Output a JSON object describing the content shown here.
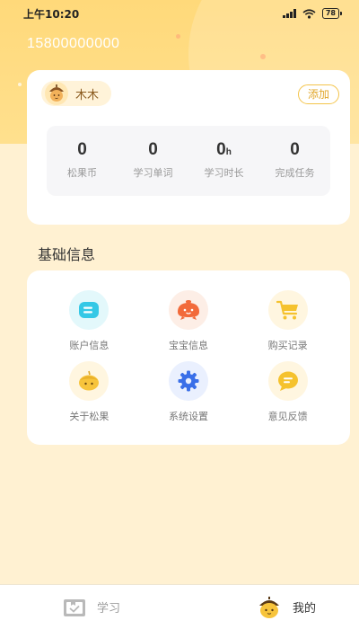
{
  "status_bar": {
    "time": "上午10:20",
    "battery": "78"
  },
  "user": {
    "phone": "15800000000",
    "child_name": "木木",
    "add_label": "添加"
  },
  "stats": [
    {
      "value": "0",
      "unit": "",
      "label": "松果币"
    },
    {
      "value": "0",
      "unit": "",
      "label": "学习单词"
    },
    {
      "value": "0",
      "unit": "h",
      "label": "学习时长"
    },
    {
      "value": "0",
      "unit": "",
      "label": "完成任务"
    }
  ],
  "section": {
    "title": "基础信息"
  },
  "menu": [
    {
      "label": "账户信息",
      "icon": "account-card-icon",
      "bg": "#E3F8FB",
      "color": "#35C8E6"
    },
    {
      "label": "宝宝信息",
      "icon": "baby-icon",
      "bg": "#FDEEE6",
      "color": "#F26A3A"
    },
    {
      "label": "购买记录",
      "icon": "shopping-cart-icon",
      "bg": "#FFF6E0",
      "color": "#F5C22E"
    },
    {
      "label": "关于松果",
      "icon": "pinecone-icon",
      "bg": "#FFF6E0",
      "color": "#F7C43C"
    },
    {
      "label": "系统设置",
      "icon": "gear-icon",
      "bg": "#EAF0FE",
      "color": "#3A6FE8"
    },
    {
      "label": "意见反馈",
      "icon": "feedback-chat-icon",
      "bg": "#FFF6E0",
      "color": "#F5C22E"
    }
  ],
  "tabs": {
    "study": "学习",
    "mine": "我的"
  },
  "colors": {
    "header_yellow": "#FFD97A",
    "accent": "#F4C44A",
    "page_bg": "#FFF1D2"
  }
}
